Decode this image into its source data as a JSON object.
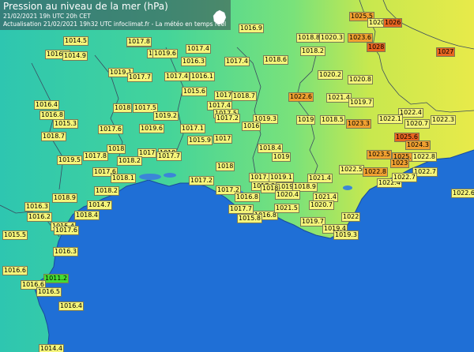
{
  "header": {
    "title": "Pression au niveau de la mer (hPa)",
    "line1": "21/02/2021  19h UTC  20h CET",
    "line2": "Actualisation 21/02/2021 19h32 UTC   infoclimat.fr - La météo en temps réel",
    "logo": "France map logo"
  },
  "colors": {
    "sea": "#1f6fd6",
    "land_low": "#2ec6b0",
    "land_mid": "#6ee08a",
    "land_high": "#e8ea4a"
  },
  "stations": [
    {
      "v": "1025.5",
      "c": "o"
    },
    {
      "v": "1020.3",
      "c": "y"
    },
    {
      "v": "1026",
      "c": "r"
    },
    {
      "v": "1016.9",
      "c": "y"
    },
    {
      "v": "1017.3",
      "c": "y"
    },
    {
      "v": "1018.8",
      "c": "y"
    },
    {
      "v": "1020.3",
      "c": "y"
    },
    {
      "v": "1023.6",
      "c": "o"
    },
    {
      "v": "1014.5",
      "c": "y"
    },
    {
      "v": "1017.8",
      "c": "y"
    },
    {
      "v": "1016.3",
      "c": "y"
    },
    {
      "v": "1014.9",
      "c": "y"
    },
    {
      "v": "1017.4",
      "c": "y"
    },
    {
      "v": "1018.6",
      "c": "y"
    },
    {
      "v": "1028",
      "c": "r"
    },
    {
      "v": "1027",
      "c": "r"
    },
    {
      "v": "1016.3",
      "c": "y"
    },
    {
      "v": "1019.6",
      "c": "y"
    },
    {
      "v": "1016.3",
      "c": "y"
    },
    {
      "v": "1017.4",
      "c": "y"
    },
    {
      "v": "1018.2",
      "c": "y"
    },
    {
      "v": "1019.1",
      "c": "y"
    },
    {
      "v": "1017.7",
      "c": "y"
    },
    {
      "v": "1017.4",
      "c": "y"
    },
    {
      "v": "1016.1",
      "c": "y"
    },
    {
      "v": "1020.2",
      "c": "y"
    },
    {
      "v": "1020.8",
      "c": "y"
    },
    {
      "v": "1015.6",
      "c": "y"
    },
    {
      "v": "1017",
      "c": "y"
    },
    {
      "v": "1018.7",
      "c": "y"
    },
    {
      "v": "1022.6",
      "c": "o"
    },
    {
      "v": "1021.4",
      "c": "y"
    },
    {
      "v": "1016.4",
      "c": "y"
    },
    {
      "v": "1018",
      "c": "y"
    },
    {
      "v": "1017.5",
      "c": "y"
    },
    {
      "v": "1017.4",
      "c": "y"
    },
    {
      "v": "1019.7",
      "c": "y"
    },
    {
      "v": "1022.4",
      "c": "y"
    },
    {
      "v": "1016.8",
      "c": "y"
    },
    {
      "v": "1019.2",
      "c": "y"
    },
    {
      "v": "1017.5",
      "c": "y"
    },
    {
      "v": "1017.2",
      "c": "y"
    },
    {
      "v": "1019.3",
      "c": "y"
    },
    {
      "v": "1019",
      "c": "y"
    },
    {
      "v": "1018.5",
      "c": "y"
    },
    {
      "v": "1022.1",
      "c": "y"
    },
    {
      "v": "1022.3",
      "c": "y"
    },
    {
      "v": "1015.3",
      "c": "y"
    },
    {
      "v": "1017.6",
      "c": "y"
    },
    {
      "v": "1019.6",
      "c": "y"
    },
    {
      "v": "1017.1",
      "c": "y"
    },
    {
      "v": "1016",
      "c": "y"
    },
    {
      "v": "1023.3",
      "c": "o"
    },
    {
      "v": "1020.7",
      "c": "y"
    },
    {
      "v": "1018.7",
      "c": "y"
    },
    {
      "v": "1015.9",
      "c": "y"
    },
    {
      "v": "1017",
      "c": "y"
    },
    {
      "v": "1025.6",
      "c": "r"
    },
    {
      "v": "1024.3",
      "c": "o"
    },
    {
      "v": "1018",
      "c": "y"
    },
    {
      "v": "1017",
      "c": "y"
    },
    {
      "v": "1018",
      "c": "y"
    },
    {
      "v": "1017.7",
      "c": "y"
    },
    {
      "v": "1018.4",
      "c": "y"
    },
    {
      "v": "1023.5",
      "c": "o"
    },
    {
      "v": "1025.4",
      "c": "o"
    },
    {
      "v": "1019.5",
      "c": "y"
    },
    {
      "v": "1017.8",
      "c": "y"
    },
    {
      "v": "1018.2",
      "c": "y"
    },
    {
      "v": "1019",
      "c": "y"
    },
    {
      "v": "1023",
      "c": "o"
    },
    {
      "v": "1022.8",
      "c": "y"
    },
    {
      "v": "1017.6",
      "c": "y"
    },
    {
      "v": "1018.1",
      "c": "y"
    },
    {
      "v": "1018",
      "c": "y"
    },
    {
      "v": "1022.5",
      "c": "y"
    },
    {
      "v": "1022.8",
      "c": "o"
    },
    {
      "v": "1022.7",
      "c": "y"
    },
    {
      "v": "1017.2",
      "c": "y"
    },
    {
      "v": "1017.9",
      "c": "y"
    },
    {
      "v": "1019.1",
      "c": "y"
    },
    {
      "v": "1022.4",
      "c": "y"
    },
    {
      "v": "1022.7",
      "c": "y"
    },
    {
      "v": "1018.2",
      "c": "y"
    },
    {
      "v": "1017.2",
      "c": "y"
    },
    {
      "v": "1017.8",
      "c": "y"
    },
    {
      "v": "1019.1",
      "c": "y"
    },
    {
      "v": "1018.9",
      "c": "y"
    },
    {
      "v": "1021.4",
      "c": "y"
    },
    {
      "v": "1022.6",
      "c": "y"
    },
    {
      "v": "1018.9",
      "c": "y"
    },
    {
      "v": "1016.8",
      "c": "y"
    },
    {
      "v": "1018",
      "c": "y"
    },
    {
      "v": "1020.4",
      "c": "y"
    },
    {
      "v": "1021.4",
      "c": "y"
    },
    {
      "v": "1016.3",
      "c": "y"
    },
    {
      "v": "1014.7",
      "c": "y"
    },
    {
      "v": "1017.7",
      "c": "y"
    },
    {
      "v": "1016.8",
      "c": "y"
    },
    {
      "v": "1021.5",
      "c": "y"
    },
    {
      "v": "1020.7",
      "c": "y"
    },
    {
      "v": "1022",
      "c": "y"
    },
    {
      "v": "1016.2",
      "c": "y"
    },
    {
      "v": "1018.4",
      "c": "y"
    },
    {
      "v": "1015.8",
      "c": "y"
    },
    {
      "v": "1019.7",
      "c": "y"
    },
    {
      "v": "1015.4",
      "c": "y"
    },
    {
      "v": "1019.4",
      "c": "y"
    },
    {
      "v": "1015.5",
      "c": "y"
    },
    {
      "v": "1017.6",
      "c": "y"
    },
    {
      "v": "1019.3",
      "c": "y"
    },
    {
      "v": "1016.3",
      "c": "y"
    },
    {
      "v": "1016.6",
      "c": "y"
    },
    {
      "v": "1011.2",
      "c": "g"
    },
    {
      "v": "1016.6",
      "c": "y"
    },
    {
      "v": "1016.5",
      "c": "y"
    },
    {
      "v": "1016.4",
      "c": "y"
    },
    {
      "v": "1014.4",
      "c": "y"
    }
  ]
}
